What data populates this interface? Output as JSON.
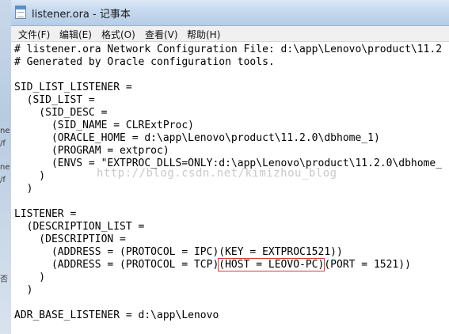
{
  "window": {
    "title": "listener.ora - 记事本",
    "background_fragments": [
      "ne",
      "/f",
      "ne",
      "/f",
      "否"
    ]
  },
  "menu": [
    "文件(F)",
    "编辑(E)",
    "格式(O)",
    "查看(V)",
    "帮助(H)"
  ],
  "editor": {
    "lines": [
      "# listener.ora Network Configuration File: d:\\app\\Lenovo\\product\\11.2",
      "# Generated by Oracle configuration tools.",
      "",
      "SID_LIST_LISTENER =",
      "  (SID_LIST =",
      "    (SID_DESC =",
      "      (SID_NAME = CLRExtProc)",
      "      (ORACLE_HOME = d:\\app\\Lenovo\\product\\11.2.0\\dbhome_1)",
      "      (PROGRAM = extproc)",
      "      (ENVS = \"EXTPROC_DLLS=ONLY:d:\\app\\Lenovo\\product\\11.2.0\\dbhome_",
      "    )",
      "  )",
      "",
      "LISTENER =",
      "  (DESCRIPTION_LIST =",
      "    (DESCRIPTION =",
      "      (ADDRESS = (PROTOCOL = IPC)(KEY = EXTPROC1521))",
      "      (ADDRESS = (PROTOCOL = TCP)",
      "    )",
      "  )",
      "",
      "ADR_BASE_LISTENER = d:\\app\\Lenovo"
    ],
    "highlighted_segment": "(HOST = LEOVO-PC)",
    "line18_suffix": "(PORT = 1521))",
    "watermark": "http://blog.csdn.net/kimizhou_blog"
  },
  "colors": {
    "highlight_box": "#d23a3a",
    "titlebar": "#c5d8ee"
  }
}
